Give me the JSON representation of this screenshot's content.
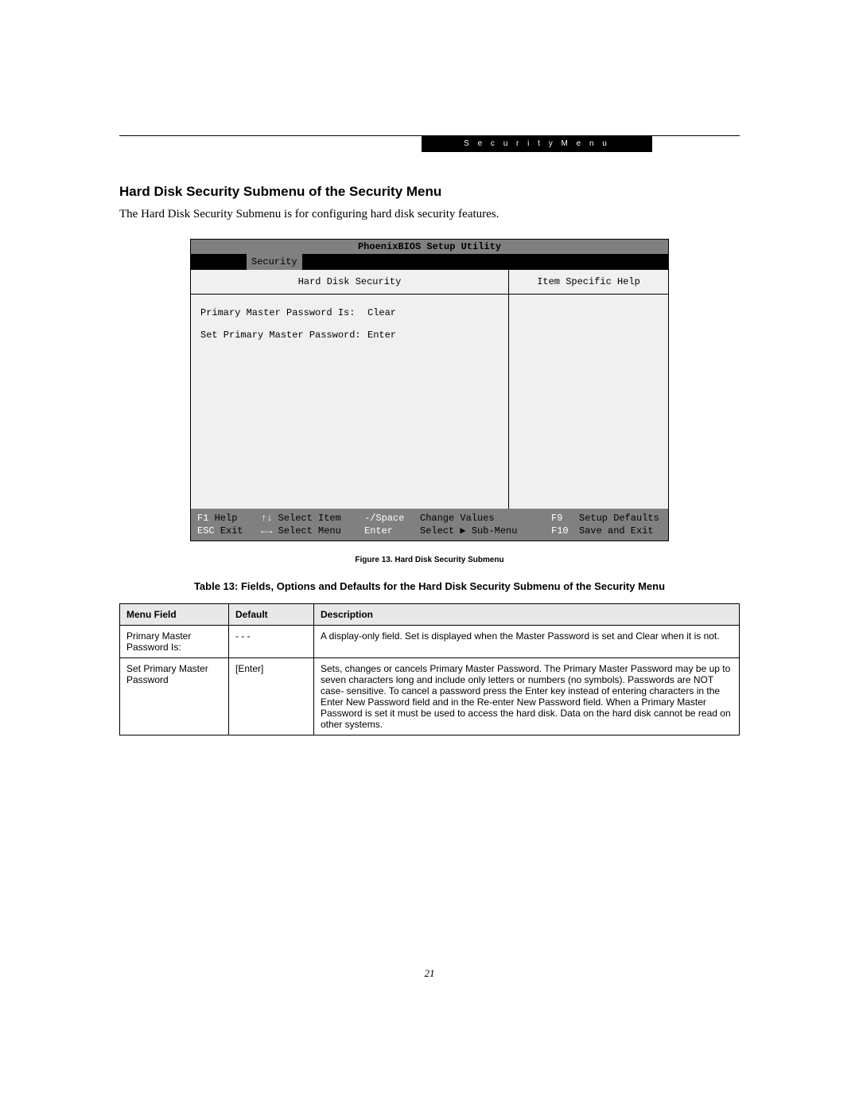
{
  "header": {
    "section": "S e c u r i t y   M e n u"
  },
  "heading": "Hard Disk Security Submenu of the Security Menu",
  "intro": "The Hard Disk Security Submenu is for configuring hard disk security features.",
  "bios": {
    "title": "PhoenixBIOS Setup Utility",
    "active_tab": "Security",
    "left_heading": "Hard Disk Security",
    "right_heading": "Item Specific Help",
    "rows": [
      {
        "label": "Primary Master Password Is:",
        "value": "Clear"
      },
      {
        "label": "Set Primary Master Password:",
        "value": "Enter"
      }
    ],
    "footer": {
      "r1": {
        "k1": "F1",
        "v1": "Help",
        "k2": "↑↓",
        "v2": "Select Item",
        "k3": "-/Space",
        "v3": "Change Values",
        "k4": "F9",
        "v4": "Setup Defaults"
      },
      "r2": {
        "k1": "ESC",
        "v1": "Exit",
        "k2": "←→",
        "v2": "Select Menu",
        "k3": "Enter",
        "v3": "Select ▶ Sub-Menu",
        "k4": "F10",
        "v4": "Save and Exit"
      }
    }
  },
  "figure_caption": "Figure 13.   Hard Disk Security Submenu",
  "table_caption": "Table 13: Fields, Options and Defaults for the Hard Disk Security Submenu of the Security Menu",
  "table": {
    "headers": {
      "c1": "Menu Field",
      "c2": "Default",
      "c3": "Description"
    },
    "rows": [
      {
        "field": "Primary Master Password Is:",
        "default": "- - -",
        "desc": "A display-only field. Set is displayed when the Master Password is set and Clear when it is not."
      },
      {
        "field": "Set Primary Master Password",
        "default": "[Enter]",
        "desc": "Sets, changes or cancels Primary Master Password. The Primary Master Password may be up to seven characters long and include only letters or numbers (no symbols). Passwords are NOT case- sensitive. To cancel a password press the Enter key instead of entering characters in the Enter New Password field and in the Re-enter New Password field. When a Primary Master Password is set it must be used to access the hard disk. Data on the hard disk cannot be read on other systems."
      }
    ]
  },
  "page_number": "21"
}
